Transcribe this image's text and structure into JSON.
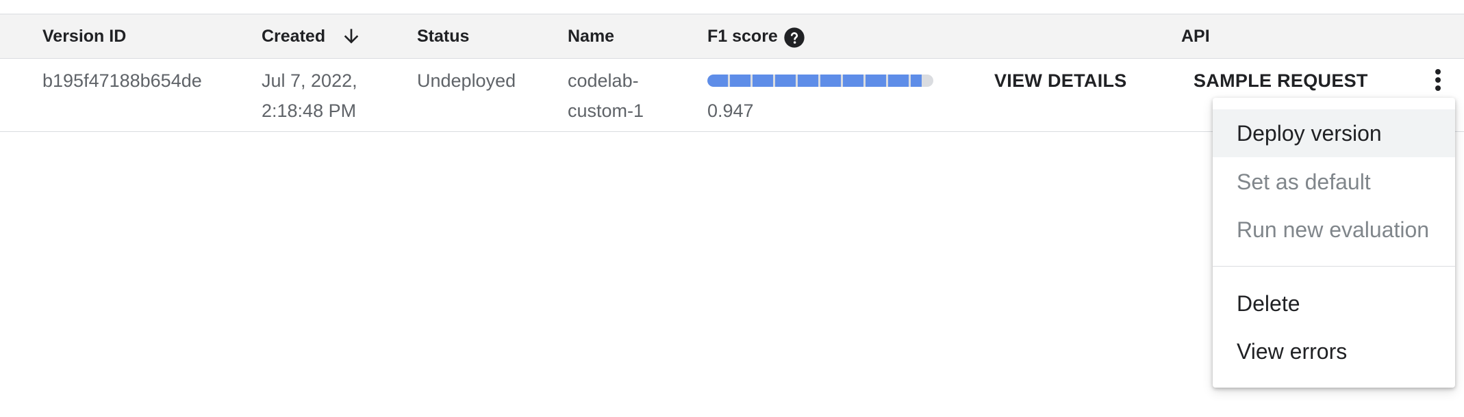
{
  "table": {
    "columns": {
      "version_id": "Version ID",
      "created": "Created",
      "status": "Status",
      "name": "Name",
      "f1_score": "F1 score",
      "api": "API"
    },
    "sort": {
      "column": "created",
      "direction": "descending",
      "icon": "arrow-down-icon"
    },
    "f1_help_icon": "help-circle-icon",
    "rows": [
      {
        "version_id": "b195f47188b654de",
        "created_line1": "Jul 7, 2022,",
        "created_line2": "2:18:48 PM",
        "status": "Undeployed",
        "name_line1": "codelab-",
        "name_line2": "custom-1",
        "f1_score": "0.947",
        "f1_fraction": 0.947,
        "view_details_label": "VIEW DETAILS",
        "sample_request_label": "SAMPLE REQUEST",
        "more_icon": "more-vert-icon"
      }
    ]
  },
  "row_menu": {
    "items": [
      {
        "label": "Deploy version",
        "state": "hover"
      },
      {
        "label": "Set as default",
        "state": "disabled"
      },
      {
        "label": "Run new evaluation",
        "state": "disabled"
      },
      {
        "label": "Delete",
        "state": "enabled"
      },
      {
        "label": "View errors",
        "state": "enabled"
      }
    ]
  },
  "colors": {
    "header_bg": "#f3f3f3",
    "progress_fill": "#5e8de8",
    "progress_track": "#dadce0",
    "text_primary": "#202124",
    "text_secondary": "#5f6368",
    "text_disabled": "#80868b"
  }
}
